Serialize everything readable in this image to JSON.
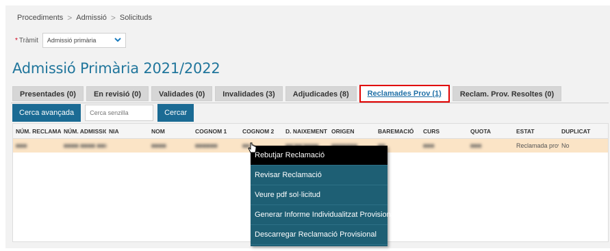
{
  "breadcrumb": [
    "Procediments",
    "Admissió",
    "Solicituds"
  ],
  "tramit": {
    "label": "Tràmit",
    "required_mark": "*",
    "value": "Admissió primària"
  },
  "page_title": "Admissió Primària 2021/2022",
  "tabs": [
    {
      "label": "Presentades (0)"
    },
    {
      "label": "En revisió (0)"
    },
    {
      "label": "Validades (0)"
    },
    {
      "label": "Invalidades (3)"
    },
    {
      "label": "Adjudicades (8)"
    },
    {
      "label": "Reclamades Prov (1)",
      "active": true
    },
    {
      "label": "Reclam. Prov. Resoltes (0)"
    }
  ],
  "toolbar": {
    "advanced_search": "Cerca avançada",
    "simple_search_placeholder": "Cerca senzilla",
    "search_button": "Cercar"
  },
  "table": {
    "columns": [
      "NÚM. RECLAMACIÓ",
      "NÚM. ADMISSIÓ",
      "NIA",
      "NOM",
      "COGNOM 1",
      "COGNOM 2",
      "D. NAIXEMENT",
      "ORIGEN",
      "BAREMACIÓ",
      "CURS",
      "QUOTA",
      "ESTAT",
      "DUPLICAT"
    ],
    "rows": [
      {
        "cells": [
          "■■■",
          "■■■■ ■■■■ ■■■",
          "",
          "■■■■",
          "■■■■■■",
          "■■",
          "■■/■■/■■■■",
          "■■■■■■■",
          "■■",
          "■■■",
          "■■■",
          "Reclamada provisio",
          "No"
        ]
      }
    ]
  },
  "context_menu": {
    "items": [
      {
        "label": "Rebutjar Reclamació",
        "hover": true
      },
      {
        "label": "Revisar Reclamació"
      },
      {
        "label": "Veure pdf sol·licitud"
      },
      {
        "label": "Generar Informe Individualitzat Provisional"
      },
      {
        "label": "Descarregar Reclamació Provisional"
      }
    ]
  },
  "colors": {
    "accent": "#1b6b94",
    "title": "#21769c",
    "active_tab_border": "#e00000",
    "row_highlight": "#fbe4c6",
    "menu_bg": "#1e5f74"
  }
}
